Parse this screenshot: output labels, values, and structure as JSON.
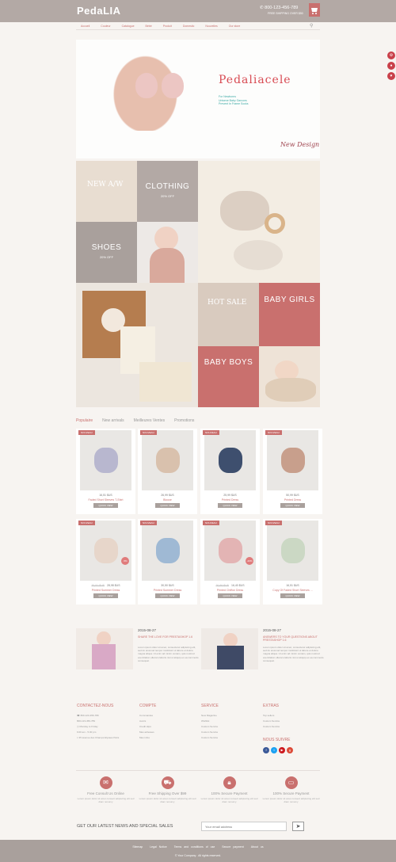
{
  "header": {
    "logo": "PedaLIA",
    "phone": "800-123-456-789",
    "shipping": "FREE SHIPPING OVER $50"
  },
  "nav": [
    "Accueil",
    "Couleur",
    "Catalogue",
    "Bébé",
    "Produit",
    "Domestic",
    "Nouvelles",
    "Our store"
  ],
  "hero": {
    "title": "Pedaliacele",
    "sub": "For Newborns\nUnisexe Baby Garcons\nPrevent In Frame Socks",
    "sign": "New Design"
  },
  "banners": {
    "clothing": "CLOTHING",
    "clothing_off": "20% OFF",
    "shoes": "SHOES",
    "shoes_off": "20% OFF",
    "baby_girls": "BABY GIRLS",
    "baby_boys": "BABY BOYS",
    "new_aw": "NEW A/W",
    "hot_sale": "HOT SALE"
  },
  "tabs": [
    "Populaire",
    "New arrivals",
    "Meilleures Ventes",
    "Promotions"
  ],
  "products": [
    {
      "badge": "NOUVEAU",
      "price": "16,51 $US",
      "name": "Faded Short Sleeves T-Shirt",
      "btn": "QUICK VIEW",
      "color": "#b8b7cf"
    },
    {
      "badge": "NOUVEAU",
      "price": "26,99 $US",
      "name": "Blouse",
      "btn": "QUICK VIEW",
      "color": "#d9c1ad"
    },
    {
      "badge": "NOUVEAU",
      "price": "25,99 $US",
      "name": "Printed Dress",
      "btn": "QUICK VIEW",
      "color": "#3e4f6e"
    },
    {
      "badge": "NOUVEAU",
      "price": "50,99 $US",
      "name": "Printed Dress",
      "btn": "QUICK VIEW",
      "color": "#c89f8c"
    },
    {
      "badge": "NOUVEAU",
      "price": "28,98 $US",
      "oldprice": "30,51 $US",
      "name": "Printed Summer Dress",
      "btn": "QUICK VIEW",
      "color": "#e7d6ca",
      "sale": "-5%"
    },
    {
      "badge": "NOUVEAU",
      "price": "30,50 $US",
      "name": "Printed Summer Dress",
      "btn": "QUICK VIEW",
      "color": "#9fb9d4"
    },
    {
      "badge": "NOUVEAU",
      "price": "16,40 $US",
      "oldprice": "20,50 $US",
      "name": "Printed Chiffon Dress",
      "btn": "QUICK VIEW",
      "color": "#e3b4b4",
      "sale": "-20%"
    },
    {
      "badge": "NOUVEAU",
      "price": "16,51 $US",
      "name": "Copy Of Faded Short Sleeves ...",
      "btn": "QUICK VIEW",
      "color": "#cbd8c4"
    }
  ],
  "blogs": [
    {
      "date": "2015-08-27",
      "title": "SHARE THE LOVE FOR PRESTASHOP 1.6",
      "text": "Lorem ipsum dolor sit amet, consectetur adipiscing elit, sed do eiusmod tempor incididunt ut labore et dolore magna aliqua. Ut enim ad minim veniam, quis nostrud exercitation ullamco laboris nisi ut aliquip ex ea commodo consequat."
    },
    {
      "date": "2015-08-27",
      "title": "ANSWERS TO YOUR QUESTIONS ABOUT PRESTASHOP 1.6",
      "text": "Lorem ipsum dolor sit amet, consectetur adipiscing elit, sed do eiusmod tempor incididunt ut labore et dolore magna aliqua. Ut enim ad minim veniam, quis nostrud exercitation ullamco laboris nisi ut aliquip ex ea commodo consequat."
    }
  ],
  "footer": {
    "contact_title": "CONTACTEZ-NOUS",
    "contact": [
      "800-123-456-789",
      "800-123-456-789",
      "Monday to Friday",
      "9.00 am - 5.00 pm",
      "35 avenue des Champs Elysées Paris"
    ],
    "compte_title": "COMPTE",
    "compte": [
      "Commandes",
      "Avoirs",
      "Credit slips",
      "Mes adresses",
      "Mes infos"
    ],
    "service_title": "SERVICE",
    "service": [
      "New Magazine",
      "Wishlist",
      "Custom Service",
      "Custom Service",
      "Custom Service"
    ],
    "extras_title": "EXTRAS",
    "extras": [
      "Top sellers",
      "Custom Service",
      "Custom Service"
    ],
    "follow": "NOUS SUIVRE",
    "social_colors": [
      "#3b5998",
      "#1da1f2",
      "#cc181e",
      "#dd4b39"
    ]
  },
  "services": [
    {
      "title": "Free Consult Us Online",
      "text": "Lorem ipsum dolor sit amet consect adipiscing elit sed diam nonumy"
    },
    {
      "title": "Free Shipping Over $99",
      "text": "Lorem ipsum dolor sit amet consect adipiscing elit sed diam nonumy"
    },
    {
      "title": "100% Secure Payment",
      "text": "Lorem ipsum dolor sit amet consect adipiscing elit sed diam nonumy"
    },
    {
      "title": "100% Secure Payment",
      "text": "Lorem ipsum dolor sit amet consect adipiscing elit sed diam nonumy"
    }
  ],
  "newsletter": {
    "label": "GET OUR LATEST NEWS AND SPECIAL SALES",
    "placeholder": "Your email address"
  },
  "bottom": {
    "links": [
      "Sitemap",
      "Legal Notice",
      "Terms and conditions of use",
      "Secure payment",
      "About us"
    ],
    "copyright": "© Your Company . All rights reserved."
  },
  "colors": {
    "accent": "#c9706e",
    "header": "#b3a9a5",
    "bg": "#f7f4f1"
  }
}
